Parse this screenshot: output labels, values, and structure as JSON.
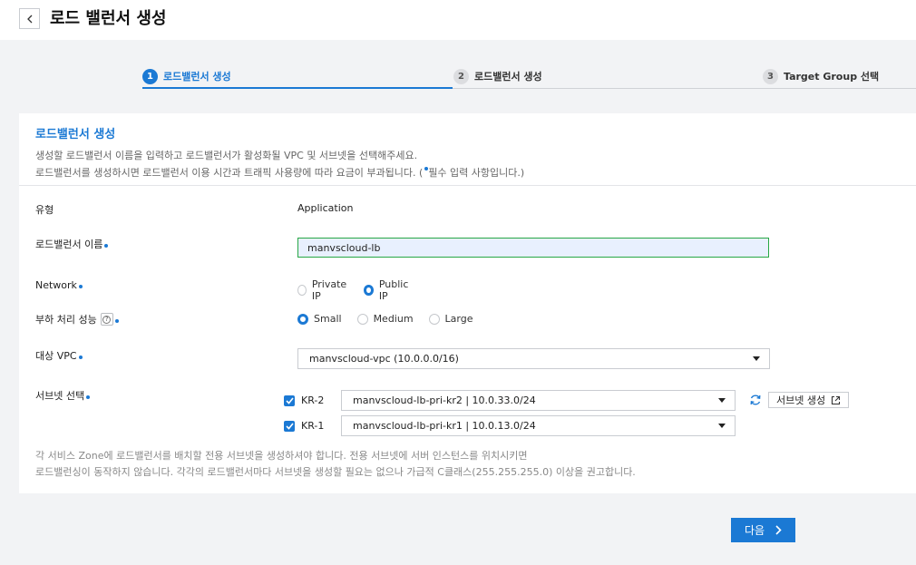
{
  "header": {
    "title": "로드 밸런서 생성"
  },
  "steps": [
    {
      "num": "1",
      "label": "로드밸런서 생성"
    },
    {
      "num": "2",
      "label": "로드밸런서 생성"
    },
    {
      "num": "3",
      "label": "Target Group 선택"
    }
  ],
  "card": {
    "title": "로드밸런서 생성",
    "desc1": "생성할 로드밸런서 이름을 입력하고 로드밸런서가 활성화될 VPC 및 서브넷을 선택해주세요.",
    "desc2_a": "로드밸런서를 생성하시면 로드밸런서 이용 시간과 트래픽 사용량에 따라 요금이 부과됩니다. (",
    "desc2_b": "필수 입력 사항입니다.)"
  },
  "form": {
    "type_label": "유형",
    "type_value": "Application",
    "name_label": "로드밸런서 이름",
    "name_value": "manvscloud-lb",
    "network_label": "Network",
    "network_options": [
      "Private IP",
      "Public IP"
    ],
    "capacity_label": "부하 처리 성능",
    "capacity_options": [
      "Small",
      "Medium",
      "Large"
    ],
    "vpc_label": "대상 VPC",
    "vpc_value": "manvscloud-vpc (10.0.0.0/16)",
    "subnet_label": "서브넷 선택",
    "subnets": [
      {
        "zone": "KR-2",
        "value": "manvscloud-lb-pri-kr2 | 10.0.33.0/24"
      },
      {
        "zone": "KR-1",
        "value": "manvscloud-lb-pri-kr1 | 10.0.13.0/24"
      }
    ],
    "create_subnet_label": "서브넷 생성"
  },
  "note": {
    "line1": "각 서비스 Zone에 로드밸런서를 배치할 전용 서브넷을 생성하셔야 합니다. 전용 서브넷에 서버 인스턴스를 위치시키면",
    "line2": "로드밸런싱이 동작하지 않습니다. 각각의 로드밸런서마다 서브넷을 생성할 필요는 없으나 가급적 C클래스(255.255.255.0) 이상을 권고합니다."
  },
  "footer": {
    "next_label": "다음"
  },
  "colors": {
    "accent": "#1b79d4",
    "success_border": "#27a745"
  }
}
